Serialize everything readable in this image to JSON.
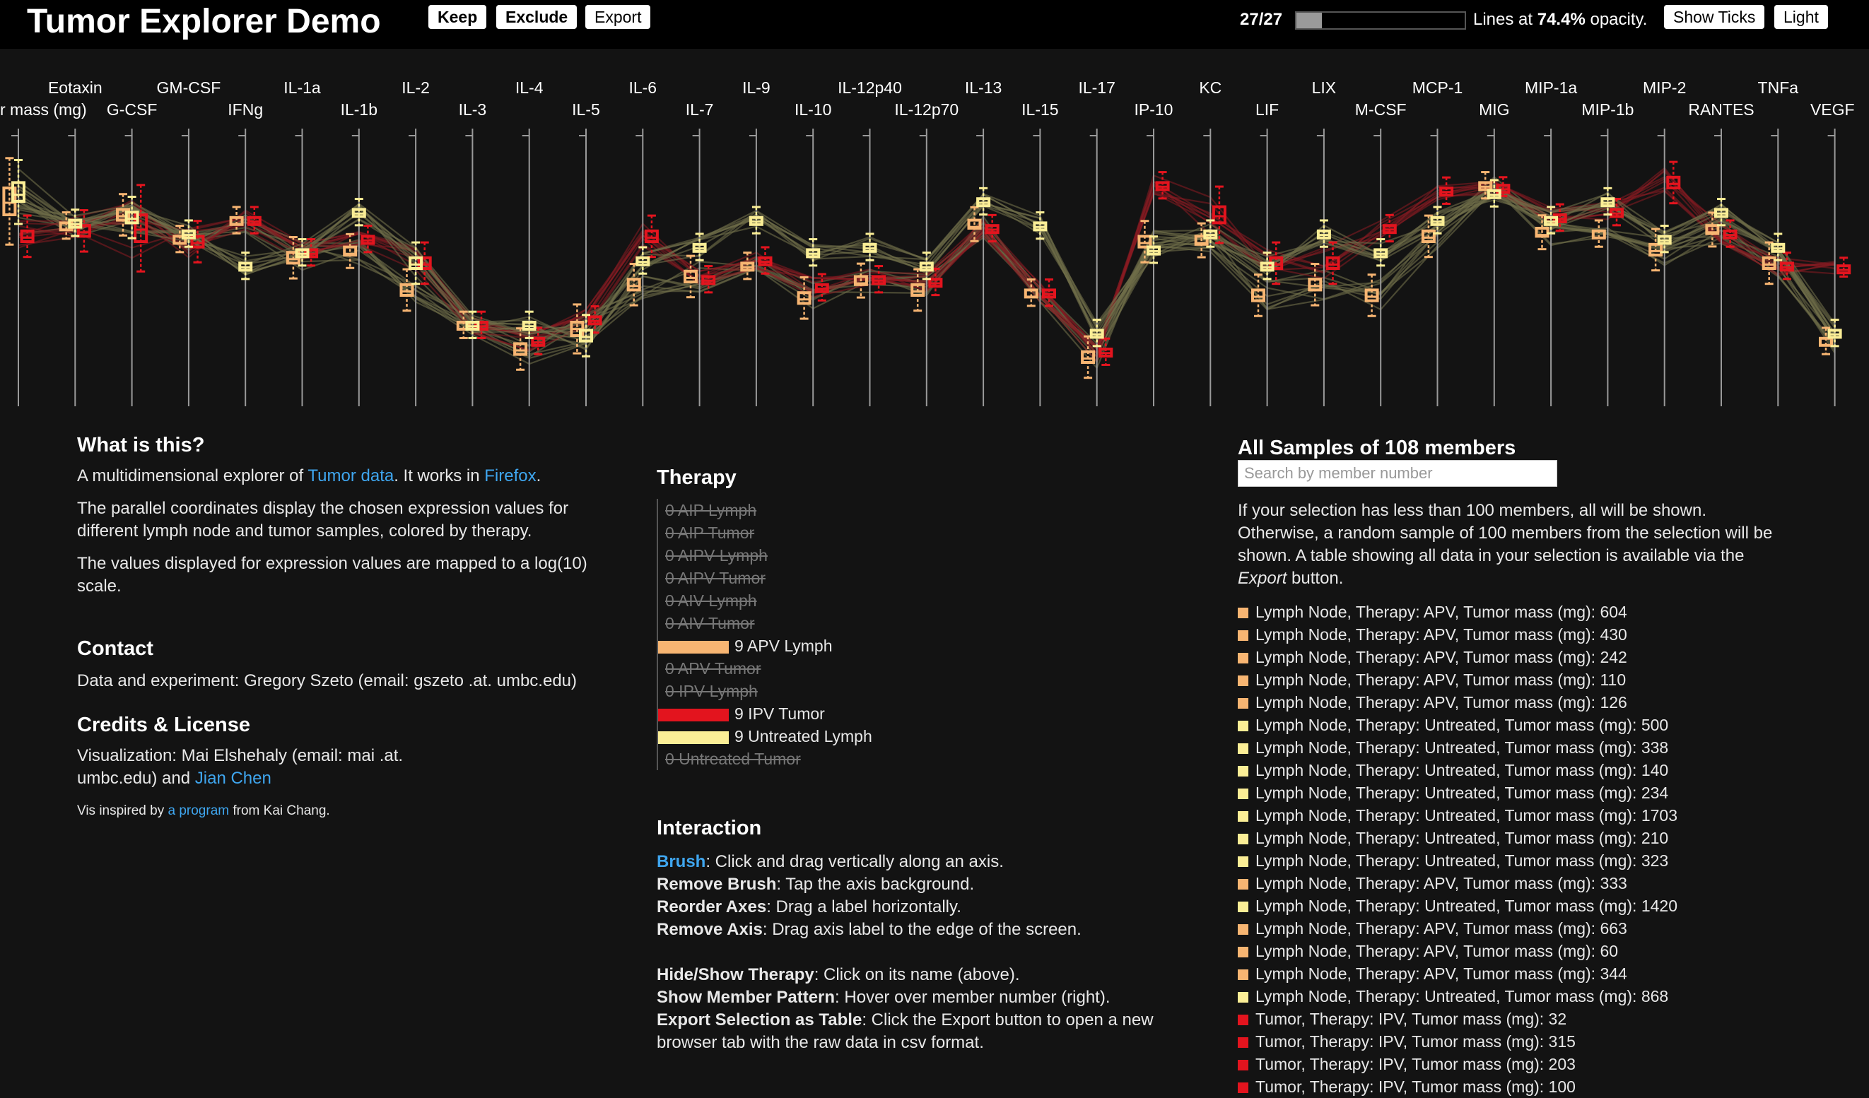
{
  "header": {
    "title": "Tumor Explorer Demo",
    "keep_label": "Keep",
    "exclude_label": "Exclude",
    "export_label": "Export",
    "selection_count": "27/27",
    "selection_fraction": 1.0,
    "opacity_prefix": "Lines at ",
    "opacity_value": "74.4%",
    "opacity_suffix": " opacity.",
    "show_ticks_label": "Show Ticks",
    "light_label": "Light"
  },
  "axes": [
    "Tumor mass (mg)",
    "Eotaxin",
    "G-CSF",
    "GM-CSF",
    "IFNg",
    "IL-1a",
    "IL-1b",
    "IL-2",
    "IL-3",
    "IL-4",
    "IL-5",
    "IL-6",
    "IL-7",
    "IL-9",
    "IL-10",
    "IL-12p40",
    "IL-12p70",
    "IL-13",
    "IL-15",
    "IL-17",
    "IP-10",
    "KC",
    "LIF",
    "LIX",
    "M-CSF",
    "MCP-1",
    "MIG",
    "MIP-1a",
    "MIP-1b",
    "MIP-2",
    "RANTES",
    "TNFa",
    "VEGF"
  ],
  "axis_label_visible": [
    "r mass (mg)",
    "Eotaxin",
    "G-CSF",
    "GM-CSF",
    "IFNg",
    "IL-1a",
    "IL-1b",
    "IL-2",
    "IL-3",
    "IL-4",
    "IL-5",
    "IL-6",
    "IL-7",
    "IL-9",
    "IL-10",
    "IL-12p40",
    "IL-12p70",
    "IL-13",
    "IL-15",
    "IL-17",
    "IP-10",
    "KC",
    "LIF",
    "LIX",
    "M-CSF",
    "MCP-1",
    "MIG",
    "MIP-1a",
    "MIP-1b",
    "MIP-2",
    "RANTES",
    "TNFa",
    "VEGF"
  ],
  "colors": {
    "apv_lymph": "#f7b572",
    "ipv_tumor": "#e3141e",
    "untreated_lymph": "#fbee96",
    "background": "#131313",
    "link": "#3fa6ef"
  },
  "chart_data": {
    "type": "parallel-coordinates",
    "scale": "log10",
    "series": [
      {
        "name": "APV Lymph",
        "color": "#f7b572",
        "q1": [
          0.3,
          0.35,
          0.32,
          0.4,
          0.33,
          0.48,
          0.45,
          0.6,
          0.72,
          0.82,
          0.75,
          0.58,
          0.55,
          0.5,
          0.63,
          0.56,
          0.6,
          0.35,
          0.6,
          0.85,
          0.42,
          0.41,
          0.62,
          0.58,
          0.62,
          0.4,
          0.2,
          0.38,
          0.38,
          0.45,
          0.37,
          0.5,
          0.78
        ],
        "median": [
          0.25,
          0.35,
          0.3,
          0.4,
          0.33,
          0.46,
          0.44,
          0.58,
          0.72,
          0.8,
          0.72,
          0.56,
          0.53,
          0.49,
          0.61,
          0.55,
          0.58,
          0.34,
          0.6,
          0.83,
          0.4,
          0.4,
          0.6,
          0.56,
          0.6,
          0.38,
          0.19,
          0.37,
          0.38,
          0.43,
          0.36,
          0.48,
          0.78
        ],
        "q3": [
          0.2,
          0.33,
          0.28,
          0.38,
          0.31,
          0.44,
          0.42,
          0.56,
          0.7,
          0.78,
          0.7,
          0.54,
          0.51,
          0.48,
          0.59,
          0.53,
          0.56,
          0.32,
          0.58,
          0.81,
          0.38,
          0.38,
          0.58,
          0.54,
          0.58,
          0.36,
          0.18,
          0.35,
          0.36,
          0.41,
          0.34,
          0.46,
          0.76
        ]
      },
      {
        "name": "IPV Tumor",
        "color": "#e3141e",
        "q1": [
          0.4,
          0.38,
          0.4,
          0.42,
          0.33,
          0.45,
          0.4,
          0.5,
          0.72,
          0.78,
          0.7,
          0.4,
          0.55,
          0.48,
          0.58,
          0.55,
          0.56,
          0.36,
          0.6,
          0.82,
          0.2,
          0.33,
          0.5,
          0.5,
          0.36,
          0.22,
          0.2,
          0.32,
          0.3,
          0.2,
          0.38,
          0.5,
          0.5
        ],
        "median": [
          0.38,
          0.36,
          0.35,
          0.4,
          0.32,
          0.44,
          0.39,
          0.48,
          0.71,
          0.77,
          0.69,
          0.38,
          0.54,
          0.47,
          0.57,
          0.54,
          0.55,
          0.35,
          0.59,
          0.81,
          0.19,
          0.3,
          0.48,
          0.48,
          0.35,
          0.21,
          0.2,
          0.31,
          0.29,
          0.18,
          0.37,
          0.49,
          0.5
        ],
        "q3": [
          0.36,
          0.34,
          0.3,
          0.38,
          0.31,
          0.43,
          0.38,
          0.46,
          0.7,
          0.76,
          0.68,
          0.36,
          0.53,
          0.46,
          0.56,
          0.53,
          0.54,
          0.34,
          0.58,
          0.8,
          0.18,
          0.27,
          0.46,
          0.46,
          0.34,
          0.2,
          0.19,
          0.3,
          0.28,
          0.16,
          0.36,
          0.48,
          0.49
        ]
      },
      {
        "name": "Untreated Lymph",
        "color": "#fbee96",
        "q1": [
          0.25,
          0.34,
          0.33,
          0.38,
          0.5,
          0.45,
          0.3,
          0.5,
          0.72,
          0.72,
          0.77,
          0.48,
          0.43,
          0.33,
          0.45,
          0.43,
          0.5,
          0.26,
          0.35,
          0.75,
          0.44,
          0.38,
          0.5,
          0.38,
          0.45,
          0.33,
          0.23,
          0.33,
          0.26,
          0.4,
          0.3,
          0.43,
          0.75
        ],
        "median": [
          0.22,
          0.33,
          0.31,
          0.37,
          0.49,
          0.44,
          0.29,
          0.48,
          0.71,
          0.71,
          0.75,
          0.47,
          0.42,
          0.32,
          0.44,
          0.42,
          0.49,
          0.25,
          0.34,
          0.74,
          0.43,
          0.37,
          0.49,
          0.37,
          0.44,
          0.32,
          0.22,
          0.32,
          0.25,
          0.39,
          0.29,
          0.42,
          0.74
        ],
        "q3": [
          0.18,
          0.32,
          0.29,
          0.36,
          0.48,
          0.43,
          0.28,
          0.46,
          0.7,
          0.7,
          0.73,
          0.46,
          0.41,
          0.31,
          0.43,
          0.41,
          0.48,
          0.24,
          0.33,
          0.73,
          0.42,
          0.36,
          0.48,
          0.36,
          0.43,
          0.31,
          0.21,
          0.31,
          0.24,
          0.38,
          0.28,
          0.41,
          0.73
        ]
      }
    ]
  },
  "what": {
    "heading": "What is this?",
    "intro_pre": "A multidimensional explorer of ",
    "intro_link1": "Tumor data",
    "intro_mid": ". It works in ",
    "intro_link2": "Firefox",
    "intro_post": ".",
    "para2": "The parallel coordinates display the chosen expression values for different lymph node and tumor samples, colored by therapy.",
    "para3": "The values displayed for expression values are mapped to a log(10) scale."
  },
  "contact": {
    "heading": "Contact",
    "text": "Data and experiment: Gregory Szeto (email: gszeto .at. umbc.edu)"
  },
  "credits": {
    "heading": "Credits & License",
    "vis_pre": "Visualization: Mai Elshehaly (email: mai .at. umbc.edu) and ",
    "vis_link": "Jian Chen",
    "inspired_pre": "Vis inspired by ",
    "inspired_link": "a program",
    "inspired_post": " from Kai Chang."
  },
  "therapy": {
    "heading": "Therapy",
    "items": [
      {
        "label": "0 AIP Lymph",
        "active": false,
        "color": ""
      },
      {
        "label": "0 AIP Tumor",
        "active": false,
        "color": ""
      },
      {
        "label": "0 AIPV Lymph",
        "active": false,
        "color": ""
      },
      {
        "label": "0 AIPV Tumor",
        "active": false,
        "color": ""
      },
      {
        "label": "0 AIV Lymph",
        "active": false,
        "color": ""
      },
      {
        "label": "0 AIV Tumor",
        "active": false,
        "color": ""
      },
      {
        "label": "9 APV Lymph",
        "active": true,
        "color": "#f7b572",
        "count": 9
      },
      {
        "label": "0 APV Tumor",
        "active": false,
        "color": ""
      },
      {
        "label": "0 IPV Lymph",
        "active": false,
        "color": ""
      },
      {
        "label": "9 IPV Tumor",
        "active": true,
        "color": "#e3141e",
        "count": 9
      },
      {
        "label": "9 Untreated Lymph",
        "active": true,
        "color": "#fbee96",
        "count": 9
      },
      {
        "label": "0 Untreated Tumor",
        "active": false,
        "color": ""
      }
    ]
  },
  "interaction": {
    "heading": "Interaction",
    "lines": [
      {
        "term": "Brush",
        "text": ": Click and drag vertically along an axis.",
        "link": true
      },
      {
        "term": "Remove Brush",
        "text": ": Tap the axis background.",
        "link": false
      },
      {
        "term": "Reorder Axes",
        "text": ": Drag a label horizontally.",
        "link": false
      },
      {
        "term": "Remove Axis",
        "text": ": Drag axis label to the edge of the screen.",
        "link": false
      }
    ],
    "lines2": [
      {
        "term": "Hide/Show Therapy",
        "text": ": Click on its name (above)."
      },
      {
        "term": "Show Member Pattern",
        "text": ": Hover over member number (right)."
      },
      {
        "term": "Export Selection as Table",
        "text": ": Click the Export button to open a new browser tab with the raw data in csv format."
      }
    ]
  },
  "samples": {
    "heading": "All Samples of 108 members",
    "search_placeholder": "Search by member number",
    "note_pre": "If your selection has less than 100 members, all will be shown. Otherwise, a random sample of 100 members from the selection will be shown. A table showing all data in your selection is available via the ",
    "note_em": "Export",
    "note_post": " button.",
    "rows": [
      {
        "text": "Lymph Node, Therapy: APV, Tumor mass (mg): 604",
        "color": "#f7b572"
      },
      {
        "text": "Lymph Node, Therapy: APV, Tumor mass (mg): 430",
        "color": "#f7b572"
      },
      {
        "text": "Lymph Node, Therapy: APV, Tumor mass (mg): 242",
        "color": "#f7b572"
      },
      {
        "text": "Lymph Node, Therapy: APV, Tumor mass (mg): 110",
        "color": "#f7b572"
      },
      {
        "text": "Lymph Node, Therapy: APV, Tumor mass (mg): 126",
        "color": "#f7b572"
      },
      {
        "text": "Lymph Node, Therapy: Untreated, Tumor mass (mg): 500",
        "color": "#fbee96"
      },
      {
        "text": "Lymph Node, Therapy: Untreated, Tumor mass (mg): 338",
        "color": "#fbee96"
      },
      {
        "text": "Lymph Node, Therapy: Untreated, Tumor mass (mg): 140",
        "color": "#fbee96"
      },
      {
        "text": "Lymph Node, Therapy: Untreated, Tumor mass (mg): 234",
        "color": "#fbee96"
      },
      {
        "text": "Lymph Node, Therapy: Untreated, Tumor mass (mg): 1703",
        "color": "#fbee96"
      },
      {
        "text": "Lymph Node, Therapy: Untreated, Tumor mass (mg): 210",
        "color": "#fbee96"
      },
      {
        "text": "Lymph Node, Therapy: Untreated, Tumor mass (mg): 323",
        "color": "#fbee96"
      },
      {
        "text": "Lymph Node, Therapy: APV, Tumor mass (mg): 333",
        "color": "#f7b572"
      },
      {
        "text": "Lymph Node, Therapy: Untreated, Tumor mass (mg): 1420",
        "color": "#fbee96"
      },
      {
        "text": "Lymph Node, Therapy: APV, Tumor mass (mg): 663",
        "color": "#f7b572"
      },
      {
        "text": "Lymph Node, Therapy: APV, Tumor mass (mg): 60",
        "color": "#f7b572"
      },
      {
        "text": "Lymph Node, Therapy: APV, Tumor mass (mg): 344",
        "color": "#f7b572"
      },
      {
        "text": "Lymph Node, Therapy: Untreated, Tumor mass (mg): 868",
        "color": "#fbee96"
      },
      {
        "text": "Tumor, Therapy: IPV, Tumor mass (mg): 32",
        "color": "#e3141e"
      },
      {
        "text": "Tumor, Therapy: IPV, Tumor mass (mg): 315",
        "color": "#e3141e"
      },
      {
        "text": "Tumor, Therapy: IPV, Tumor mass (mg): 203",
        "color": "#e3141e"
      },
      {
        "text": "Tumor, Therapy: IPV, Tumor mass (mg): 100",
        "color": "#e3141e"
      }
    ]
  }
}
